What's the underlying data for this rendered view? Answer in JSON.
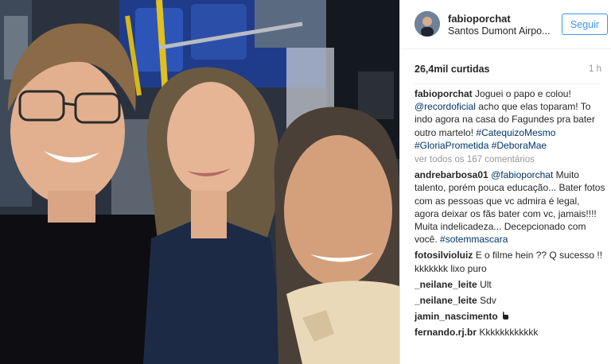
{
  "post": {
    "username": "fabioporchat",
    "location": "Santos Dumont Airpo...",
    "follow_label": "Seguir",
    "likes": "26,4mil curtidas",
    "time": "1 h"
  },
  "caption": {
    "username": "fabioporchat",
    "text1": "Joguei o papo e colou!",
    "mention": "@recordoficial",
    "text2": "acho que elas toparam! To indo agora na casa do Fagundes pra bater outro martelo!",
    "tag1": "#CatequizoMesmo",
    "tag2": "#GloriaPrometida",
    "tag3": "#DeboraMae"
  },
  "view_all": "ver todos os 167 comentários",
  "comments": [
    {
      "user": "andrebarbosa01",
      "mention": "@fabioporchat",
      "text": "Muito talento, porém pouca educação... Bater fotos com as pessoas que vc admira é legal, agora deixar os fãs bater com vc, jamais!!!! Muita indelicadeza... Decepcionado com você.",
      "tag": "#sotemmascara"
    },
    {
      "user": "fotosilvioluiz",
      "text": "E o filme hein ?? Q sucesso !! kkkkkkk lixo puro"
    },
    {
      "user": "_neilane_leite",
      "text": "Ult"
    },
    {
      "user": "_neilane_leite",
      "text": "Sdv"
    },
    {
      "user": "jamin_nascimento",
      "icon": "pointing-hand-icon"
    },
    {
      "user": "fernando.rj.br",
      "text": "Kkkkkkkkkkkk"
    }
  ],
  "colors": {
    "link": "#003569",
    "follow": "#3897f0",
    "muted": "#999999"
  }
}
